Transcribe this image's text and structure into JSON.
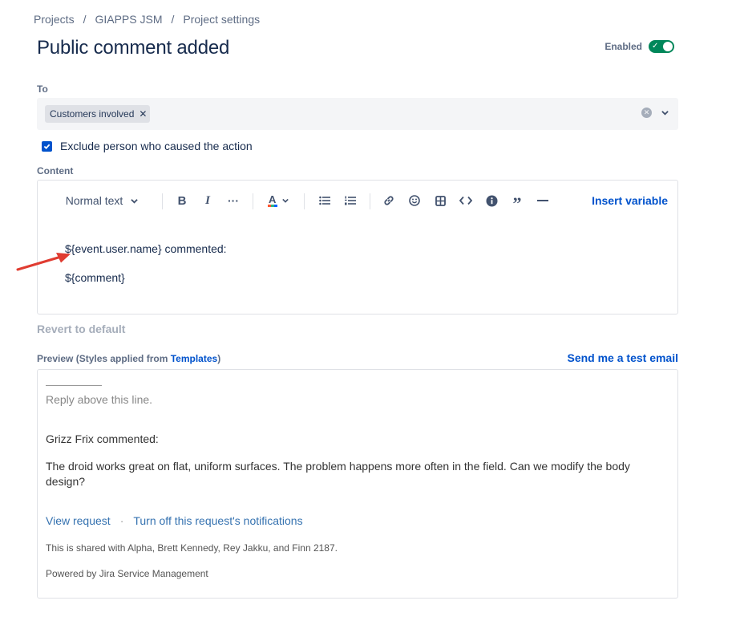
{
  "breadcrumb": [
    "Projects",
    "GIAPPS JSM",
    "Project settings"
  ],
  "page_title": "Public comment added",
  "enabled": {
    "label": "Enabled",
    "on": true
  },
  "to": {
    "label": "To",
    "chips": [
      "Customers involved"
    ]
  },
  "exclude_checkbox": {
    "label": "Exclude person who caused the action",
    "checked": true
  },
  "content": {
    "label": "Content",
    "toolbar": {
      "text_style": "Normal text",
      "insert_variable": "Insert variable",
      "icons": [
        "bold-icon",
        "italic-icon",
        "more-icon",
        "text-color-icon",
        "bullet-list-icon",
        "numbered-list-icon",
        "link-icon",
        "emoji-icon",
        "table-icon",
        "code-icon",
        "info-icon",
        "quote-icon",
        "divider-icon"
      ]
    },
    "lines": [
      "${event.user.name} commented:",
      "${comment}"
    ]
  },
  "revert_label": "Revert to default",
  "preview": {
    "label_prefix": "Preview (Styles applied from ",
    "label_link": "Templates",
    "label_suffix": ")",
    "send_test": "Send me a test email",
    "rule": "__________",
    "reply_above": "Reply above this line.",
    "commenter": "Grizz Frix commented:",
    "body": "The droid works great on flat, uniform surfaces. The problem happens more often in the field. Can we modify the body design?",
    "view_request": "View request",
    "link_separator": "·",
    "turn_off": "Turn off this request's notifications",
    "shared_with": "This is shared with Alpha, Brett Kennedy, Rey Jakku, and Finn 2187.",
    "powered_by": "Powered by Jira Service Management"
  },
  "colors": {
    "accent": "#0052cc",
    "toggle_on": "#00875a",
    "annotation_arrow": "#e03c31"
  }
}
